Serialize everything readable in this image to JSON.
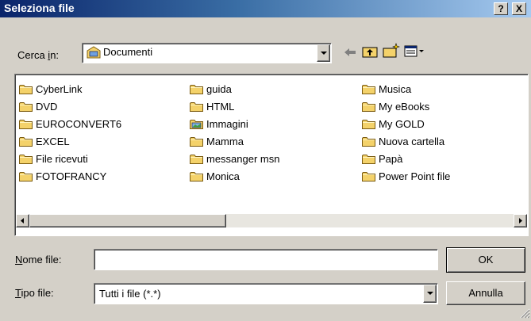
{
  "window": {
    "title": "Seleziona file",
    "help_button": "?",
    "close_button": "X"
  },
  "look_in": {
    "label_pre": "Cerca ",
    "label_accel": "i",
    "label_post": "n:",
    "value": "Documenti"
  },
  "toolbar": {
    "icons": [
      "back-arrow-icon",
      "up-folder-icon",
      "new-folder-icon",
      "view-menu-icon"
    ]
  },
  "files": {
    "col1": [
      "CyberLink",
      "DVD",
      "EUROCONVERT6",
      "EXCEL",
      "File ricevuti",
      "FOTOFRANCY"
    ],
    "col2": [
      "guida",
      "HTML",
      "Immagini",
      "Mamma",
      "messanger msn",
      "Monica"
    ],
    "col3": [
      "Musica",
      "My eBooks",
      "My GOLD",
      "Nuova cartella",
      "Papà",
      "Power Point file"
    ]
  },
  "filename": {
    "label_accel": "N",
    "label_rest": "ome file:",
    "value": ""
  },
  "filetype": {
    "label_accel": "T",
    "label_rest": "ipo file:",
    "value": "Tutti i file (*.*)"
  },
  "buttons": {
    "ok": "OK",
    "cancel": "Annulla"
  },
  "colors": {
    "title_start": "#0a246a",
    "title_end": "#a6caf0",
    "face": "#d4d0c8",
    "folder": "#f4d26a"
  }
}
